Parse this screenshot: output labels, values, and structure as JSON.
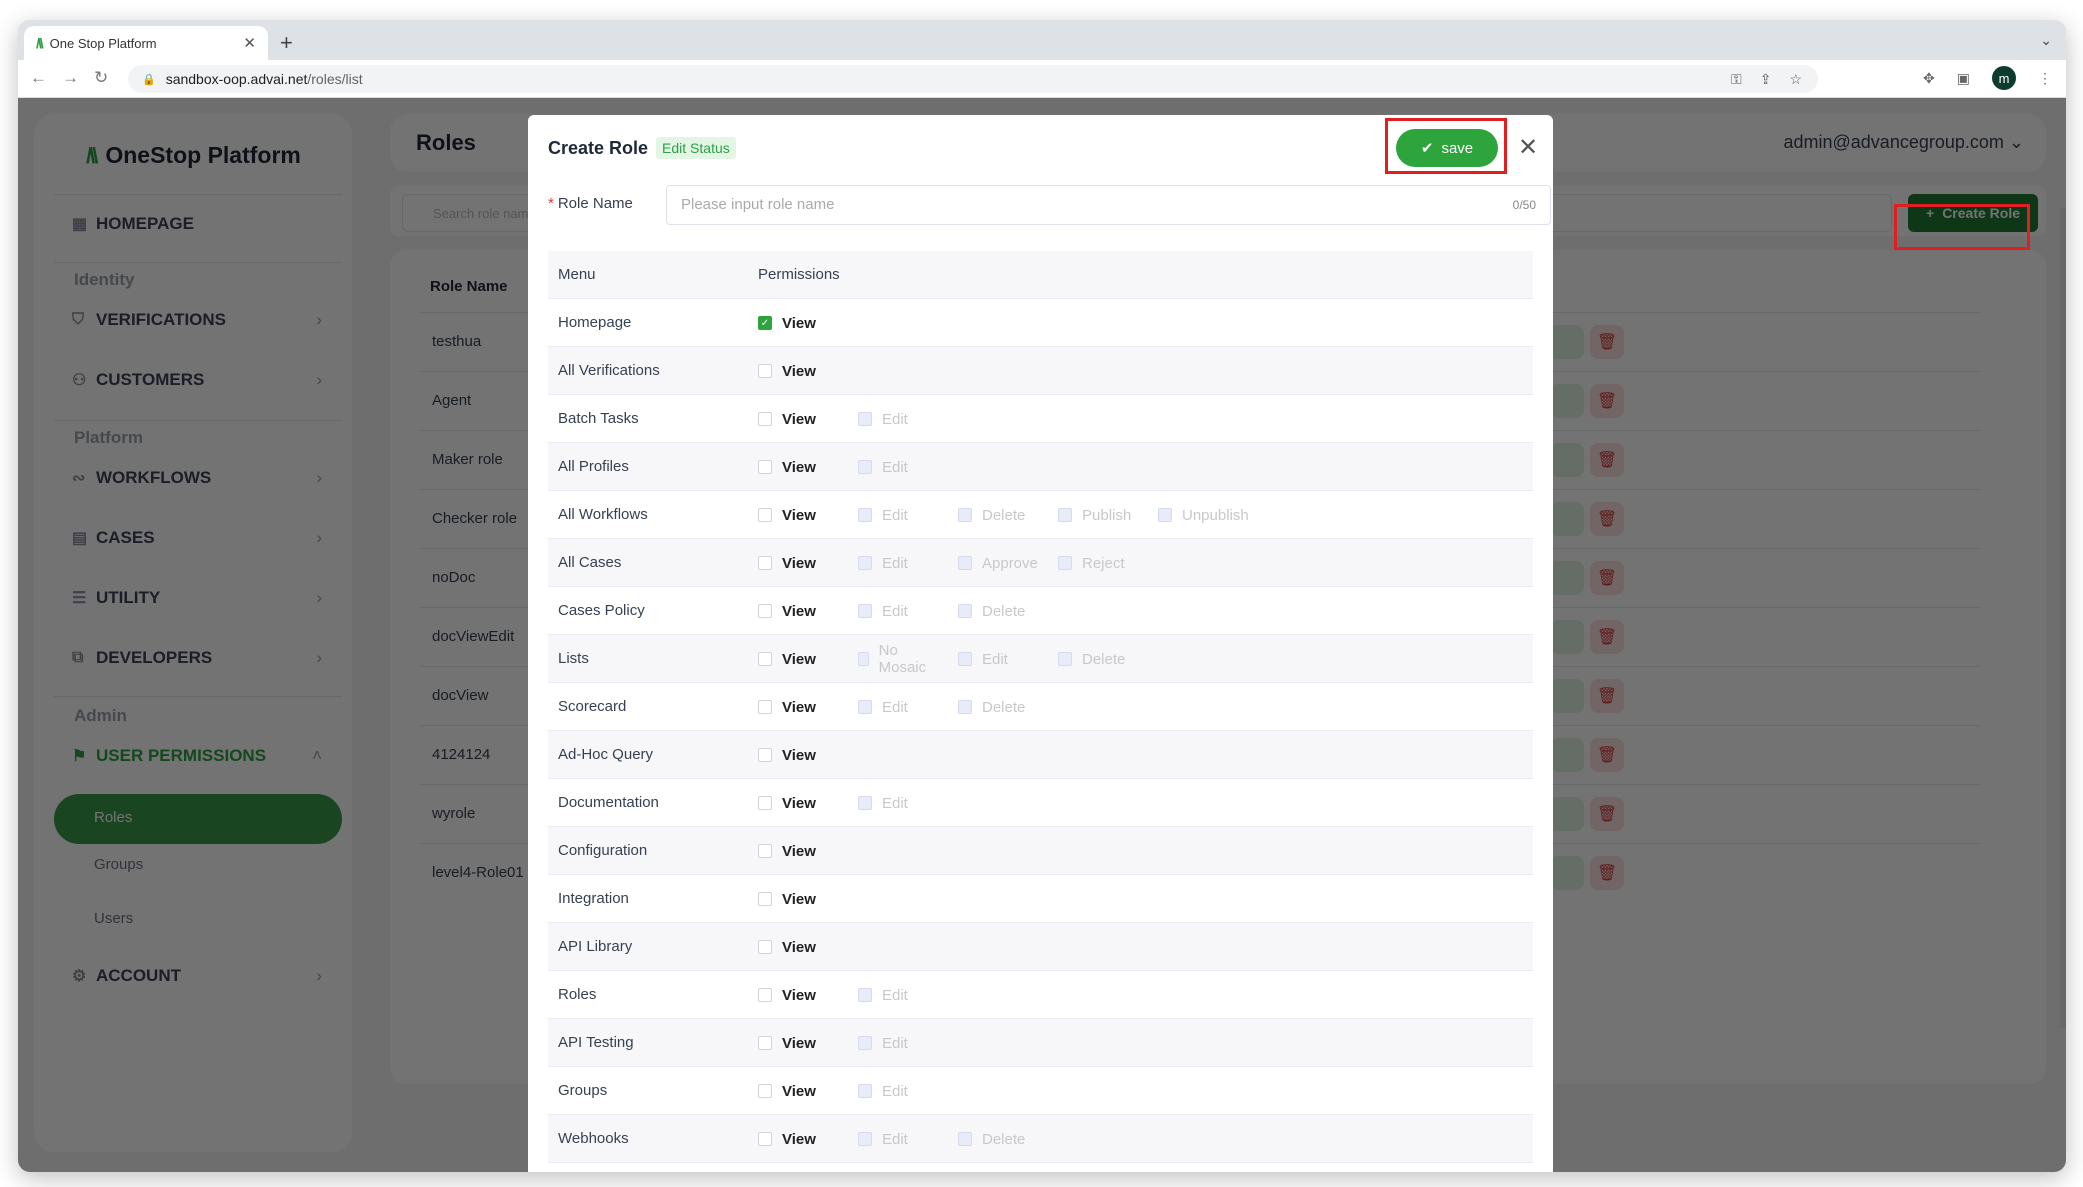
{
  "browser": {
    "tab_title": "One Stop Platform",
    "url_host": "sandbox-oop.advai.net",
    "url_path": "/roles/list",
    "profile_initial": "m"
  },
  "sidebar": {
    "brand": "OneStop Platform",
    "homepage": "HOMEPAGE",
    "sections": {
      "identity": "Identity",
      "platform": "Platform",
      "admin": "Admin"
    },
    "items": {
      "verifications": "VERIFICATIONS",
      "customers": "CUSTOMERS",
      "workflows": "WORKFLOWS",
      "cases": "CASES",
      "utility": "UTILITY",
      "developers": "DEVELOPERS",
      "user_permissions": "USER PERMISSIONS",
      "account": "ACCOUNT"
    },
    "sub_items": {
      "roles": "Roles",
      "groups": "Groups",
      "users": "Users"
    }
  },
  "header": {
    "title": "Roles",
    "user": "admin@advancegroup.com"
  },
  "toolbar": {
    "search_placeholder": "Search role name",
    "create_label": "Create Role"
  },
  "roles_list": {
    "column": "Role Name",
    "rows": [
      "testhua",
      "Agent",
      "Maker role",
      "Checker role",
      "noDoc",
      "docViewEdit",
      "docView",
      "4124124",
      "wyrole",
      "level4-Role01"
    ]
  },
  "modal": {
    "title": "Create Role",
    "status_badge": "Edit Status",
    "save_label": "save",
    "role_name_label": "Role Name",
    "role_name_placeholder": "Please input role name",
    "role_name_value": "",
    "char_count": "0/50",
    "table_headers": {
      "menu": "Menu",
      "permissions": "Permissions"
    },
    "permissions": [
      {
        "menu": "Homepage",
        "perms": [
          {
            "label": "View",
            "checked": true,
            "enabled": true
          }
        ]
      },
      {
        "menu": "All Verifications",
        "perms": [
          {
            "label": "View",
            "checked": false,
            "enabled": true
          }
        ]
      },
      {
        "menu": "Batch Tasks",
        "perms": [
          {
            "label": "View",
            "checked": false,
            "enabled": true
          },
          {
            "label": "Edit",
            "checked": false,
            "enabled": false
          }
        ]
      },
      {
        "menu": "All Profiles",
        "perms": [
          {
            "label": "View",
            "checked": false,
            "enabled": true
          },
          {
            "label": "Edit",
            "checked": false,
            "enabled": false
          }
        ]
      },
      {
        "menu": "All Workflows",
        "perms": [
          {
            "label": "View",
            "checked": false,
            "enabled": true
          },
          {
            "label": "Edit",
            "checked": false,
            "enabled": false
          },
          {
            "label": "Delete",
            "checked": false,
            "enabled": false
          },
          {
            "label": "Publish",
            "checked": false,
            "enabled": false
          },
          {
            "label": "Unpublish",
            "checked": false,
            "enabled": false
          }
        ]
      },
      {
        "menu": "All Cases",
        "perms": [
          {
            "label": "View",
            "checked": false,
            "enabled": true
          },
          {
            "label": "Edit",
            "checked": false,
            "enabled": false
          },
          {
            "label": "Approve",
            "checked": false,
            "enabled": false
          },
          {
            "label": "Reject",
            "checked": false,
            "enabled": false
          }
        ]
      },
      {
        "menu": "Cases Policy",
        "perms": [
          {
            "label": "View",
            "checked": false,
            "enabled": true
          },
          {
            "label": "Edit",
            "checked": false,
            "enabled": false
          },
          {
            "label": "Delete",
            "checked": false,
            "enabled": false
          }
        ]
      },
      {
        "menu": "Lists",
        "perms": [
          {
            "label": "View",
            "checked": false,
            "enabled": true
          },
          {
            "label": "No Mosaic",
            "checked": false,
            "enabled": false
          },
          {
            "label": "Edit",
            "checked": false,
            "enabled": false
          },
          {
            "label": "Delete",
            "checked": false,
            "enabled": false
          }
        ]
      },
      {
        "menu": "Scorecard",
        "perms": [
          {
            "label": "View",
            "checked": false,
            "enabled": true
          },
          {
            "label": "Edit",
            "checked": false,
            "enabled": false
          },
          {
            "label": "Delete",
            "checked": false,
            "enabled": false
          }
        ]
      },
      {
        "menu": "Ad-Hoc Query",
        "perms": [
          {
            "label": "View",
            "checked": false,
            "enabled": true
          }
        ]
      },
      {
        "menu": "Documentation",
        "perms": [
          {
            "label": "View",
            "checked": false,
            "enabled": true
          },
          {
            "label": "Edit",
            "checked": false,
            "enabled": false
          }
        ]
      },
      {
        "menu": "Configuration",
        "perms": [
          {
            "label": "View",
            "checked": false,
            "enabled": true
          }
        ]
      },
      {
        "menu": "Integration",
        "perms": [
          {
            "label": "View",
            "checked": false,
            "enabled": true
          }
        ]
      },
      {
        "menu": "API Library",
        "perms": [
          {
            "label": "View",
            "checked": false,
            "enabled": true
          }
        ]
      },
      {
        "menu": "Roles",
        "perms": [
          {
            "label": "View",
            "checked": false,
            "enabled": true
          },
          {
            "label": "Edit",
            "checked": false,
            "enabled": false
          }
        ]
      },
      {
        "menu": "API Testing",
        "perms": [
          {
            "label": "View",
            "checked": false,
            "enabled": true
          },
          {
            "label": "Edit",
            "checked": false,
            "enabled": false
          }
        ]
      },
      {
        "menu": "Groups",
        "perms": [
          {
            "label": "View",
            "checked": false,
            "enabled": true
          },
          {
            "label": "Edit",
            "checked": false,
            "enabled": false
          }
        ]
      },
      {
        "menu": "Webhooks",
        "perms": [
          {
            "label": "View",
            "checked": false,
            "enabled": true
          },
          {
            "label": "Edit",
            "checked": false,
            "enabled": false
          },
          {
            "label": "Delete",
            "checked": false,
            "enabled": false
          }
        ]
      }
    ]
  }
}
